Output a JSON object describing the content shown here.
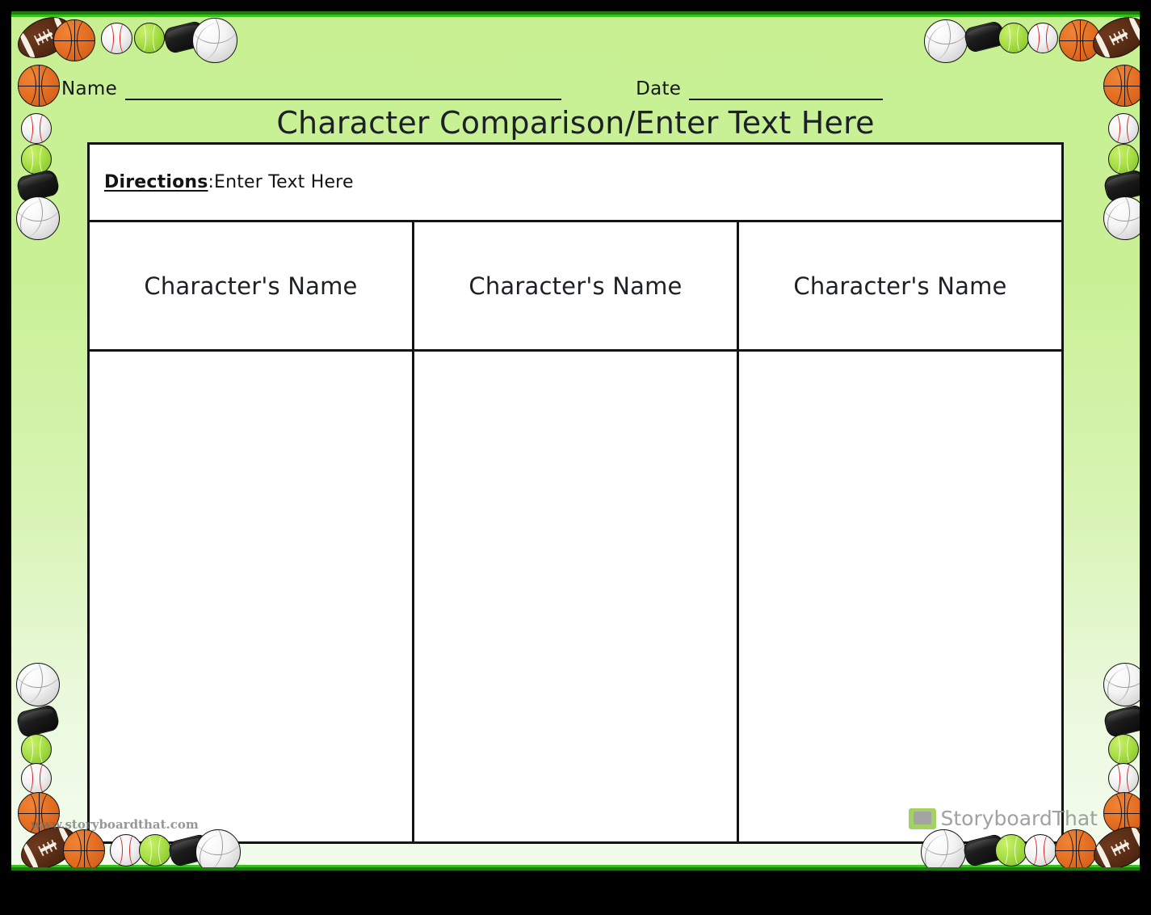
{
  "document": {
    "title": "Character Comparison/Enter Text Here",
    "theme": "sports-balls-green-border",
    "colors": {
      "page_background": "#000000",
      "sheet_top": "#c8f093",
      "sheet_bottom": "#f3fbec",
      "border_green_dark": "#1f7a0f",
      "border_green_bright": "#37c21a",
      "table_border": "#141414",
      "text": "#1d2026"
    }
  },
  "header": {
    "name_label": "Name",
    "name_value": "",
    "name_placeholder": "",
    "date_label": "Date",
    "date_value": "",
    "date_placeholder": ""
  },
  "directions": {
    "label": "Directions",
    "separator": ": ",
    "text": "Enter Text Here"
  },
  "table": {
    "column_headers": [
      "Character's Name",
      "Character's Name",
      "Character's Name"
    ],
    "body_cells": [
      "",
      "",
      ""
    ]
  },
  "watermarks": {
    "url": "www.storyboardthat.com",
    "brand": "StoryboardThat",
    "brand_icon": "storyboard-logo-icon"
  },
  "decorations": {
    "ball_types": [
      "football",
      "basketball",
      "baseball",
      "tennis-ball",
      "hockey-puck",
      "volleyball"
    ],
    "top_left_sequence": [
      "football",
      "basketball",
      "baseball",
      "tennis-ball",
      "hockey-puck",
      "volleyball"
    ],
    "top_right_sequence": [
      "volleyball",
      "hockey-puck",
      "tennis-ball",
      "baseball",
      "basketball",
      "football"
    ],
    "left_edge_sequence": [
      "basketball",
      "baseball",
      "tennis-ball",
      "hockey-puck",
      "volleyball"
    ],
    "right_edge_sequence": [
      "basketball",
      "baseball",
      "tennis-ball",
      "hockey-puck",
      "volleyball"
    ],
    "bottom_left_sequence": [
      "football",
      "basketball",
      "baseball",
      "tennis-ball",
      "hockey-puck",
      "volleyball"
    ],
    "bottom_right_sequence": [
      "volleyball",
      "hockey-puck",
      "tennis-ball",
      "baseball",
      "basketball",
      "football"
    ]
  }
}
